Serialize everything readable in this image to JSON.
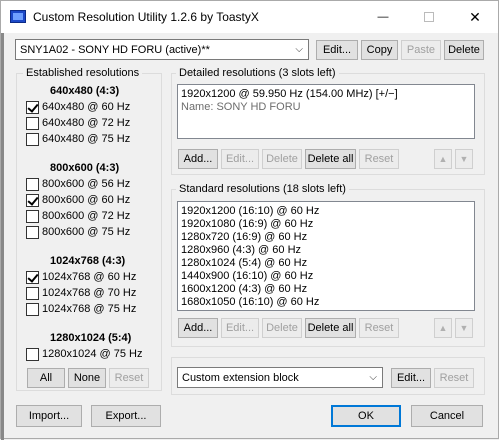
{
  "window": {
    "title": "Custom Resolution Utility 1.2.6 by ToastyX",
    "minimize_glyph": "—",
    "close_glyph": "✕"
  },
  "top": {
    "monitor_select_value": "SNY1A02 - SONY HD FORU (active)**",
    "edit_label": "Edit...",
    "copy_label": "Copy",
    "paste_label": "Paste",
    "delete_label": "Delete"
  },
  "established": {
    "group_label": "Established resolutions",
    "sections": [
      {
        "header": "640x480 (4:3)",
        "items": [
          {
            "label": "640x480 @ 60 Hz",
            "checked": true
          },
          {
            "label": "640x480 @ 72 Hz",
            "checked": false
          },
          {
            "label": "640x480 @ 75 Hz",
            "checked": false
          }
        ]
      },
      {
        "header": "800x600 (4:3)",
        "items": [
          {
            "label": "800x600 @ 56 Hz",
            "checked": false
          },
          {
            "label": "800x600 @ 60 Hz",
            "checked": true
          },
          {
            "label": "800x600 @ 72 Hz",
            "checked": false
          },
          {
            "label": "800x600 @ 75 Hz",
            "checked": false
          }
        ]
      },
      {
        "header": "1024x768 (4:3)",
        "items": [
          {
            "label": "1024x768 @ 60 Hz",
            "checked": true
          },
          {
            "label": "1024x768 @ 70 Hz",
            "checked": false
          },
          {
            "label": "1024x768 @ 75 Hz",
            "checked": false
          }
        ]
      },
      {
        "header": "1280x1024 (5:4)",
        "items": [
          {
            "label": "1280x1024 @ 75 Hz",
            "checked": false
          }
        ]
      }
    ],
    "all_label": "All",
    "none_label": "None",
    "reset_label": "Reset"
  },
  "detailed": {
    "group_label": "Detailed resolutions (3 slots left)",
    "rows": [
      "1920x1200 @ 59.950 Hz (154.00 MHz) [+/−]",
      "Name: SONY HD FORU"
    ],
    "add_label": "Add...",
    "edit_label": "Edit...",
    "delete_label": "Delete",
    "delete_all_label": "Delete all",
    "reset_label": "Reset",
    "up_glyph": "▲",
    "down_glyph": "▼"
  },
  "standard": {
    "group_label": "Standard resolutions (18 slots left)",
    "rows": [
      "1920x1200 (16:10) @ 60 Hz",
      "1920x1080 (16:9) @ 60 Hz",
      "1280x720 (16:9) @ 60 Hz",
      "1280x960 (4:3) @ 60 Hz",
      "1280x1024 (5:4) @ 60 Hz",
      "1440x900 (16:10) @ 60 Hz",
      "1600x1200 (4:3) @ 60 Hz",
      "1680x1050 (16:10) @ 60 Hz"
    ],
    "add_label": "Add...",
    "edit_label": "Edit...",
    "delete_label": "Delete",
    "delete_all_label": "Delete all",
    "reset_label": "Reset",
    "up_glyph": "▲",
    "down_glyph": "▼"
  },
  "extension": {
    "select_value": "Custom extension block",
    "edit_label": "Edit...",
    "reset_label": "Reset"
  },
  "footer": {
    "import_label": "Import...",
    "export_label": "Export...",
    "ok_label": "OK",
    "cancel_label": "Cancel"
  }
}
